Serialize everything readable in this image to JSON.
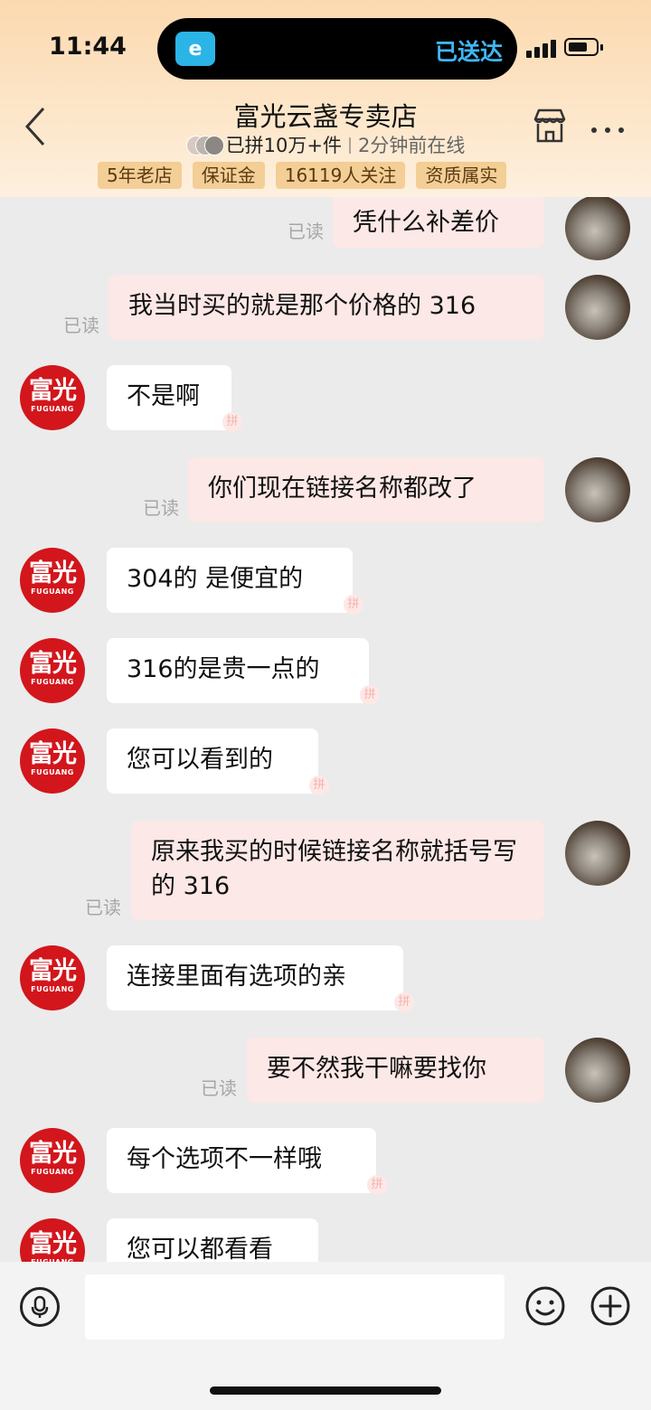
{
  "status_bar": {
    "time": "11:44",
    "island_app_glyph": "e",
    "island_text": "已送达"
  },
  "header": {
    "title": "富光云盏专卖店",
    "sales": "已拼10万+件",
    "online": "2分钟前在线",
    "tags": [
      "5年老店",
      "保证金",
      "16119人关注",
      "资质属实"
    ]
  },
  "shop_avatar": {
    "cn": "富光",
    "en": "FUGUANG"
  },
  "pin_glyph": "拼",
  "messages": [
    {
      "from": "me",
      "text": "凭什么补差价",
      "read": "已读"
    },
    {
      "from": "me",
      "text": "我当时买的就是那个价格的 316",
      "read": "已读"
    },
    {
      "from": "shop",
      "text": "不是啊"
    },
    {
      "from": "me",
      "text": "你们现在链接名称都改了",
      "read": "已读"
    },
    {
      "from": "shop",
      "text": "304的 是便宜的"
    },
    {
      "from": "shop",
      "text": "316的是贵一点的"
    },
    {
      "from": "shop",
      "text": "您可以看到的"
    },
    {
      "from": "me",
      "text": "原来我买的时候链接名称就括号写的 316",
      "read": "已读"
    },
    {
      "from": "shop",
      "text": "连接里面有选项的亲"
    },
    {
      "from": "me",
      "text": "要不然我干嘛要找你",
      "read": "已读"
    },
    {
      "from": "shop",
      "text": "每个选项不一样哦"
    },
    {
      "from": "shop",
      "text": "您可以都看看"
    }
  ],
  "colors": {
    "shop_red": "#d2161c",
    "my_bubble": "#fce8e6",
    "header_bg": "#fde3c3",
    "read_text": "#a6a6a6"
  },
  "icons": [
    "back-chevron-icon",
    "shop-icon",
    "more-icon",
    "mic-icon",
    "emoji-icon",
    "plus-icon"
  ]
}
